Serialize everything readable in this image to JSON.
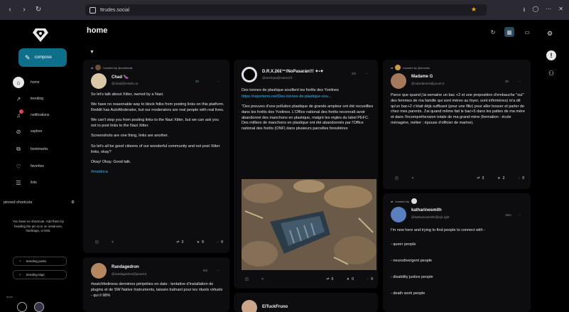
{
  "browser": {
    "url": "ttrudes.social",
    "back_glyph": "‹",
    "forward_glyph": "›",
    "reload_glyph": "↻",
    "right_icons": [
      "⭳",
      "◯",
      "⋯",
      "✕"
    ]
  },
  "sidebar": {
    "compose_label": "compose",
    "items": [
      {
        "label": "home",
        "icon": "home-icon",
        "glyph": "⌂"
      },
      {
        "label": "trending",
        "icon": "trending-icon",
        "glyph": "↗"
      },
      {
        "label": "notifications",
        "icon": "bell-icon",
        "glyph": "♫"
      },
      {
        "label": "explore",
        "icon": "compass-icon",
        "glyph": "⊘"
      },
      {
        "label": "bookmarks",
        "icon": "bookmark-icon",
        "glyph": "⧉"
      },
      {
        "label": "favorites",
        "icon": "heart-icon",
        "glyph": "♡"
      },
      {
        "label": "lists",
        "icon": "list-icon",
        "glyph": "☰"
      }
    ],
    "pinned_title": "pinned shortcuts",
    "pinned_note": "You have no shortcuts. Add them by heading the pin icon on instances, hashtags, or lists.",
    "pinned_buttons": [
      "trending posts",
      "trending tags"
    ],
    "more_label": "more"
  },
  "main": {
    "title": "home",
    "filter_glyph": "▼",
    "posts": [
      {
        "boost_text": "boosted by  @crabenak",
        "name": "Chad 🍆",
        "handle": "@chad@mstdn.ca",
        "meta": "2h",
        "paragraphs": [
          "So let's talk about Xitter, owned by a Nazi.",
          "We have no reasonable way to block folks from posting links on this platform. Reddit has AutoModerator, but our moderators are real people with real lives.",
          "We can't stop you from posting links to the Nazi Xitter, but we can ask you not to post links to the Nazi Xitter.",
          "Screenshots are one thing, links are another.",
          "So let's all be good citizens of our wonderful community and not post Xitter links, okay?",
          "Okay! Okay. Good talk."
        ],
        "hashtag": "#mstdnca",
        "counts": {
          "boosts": "3",
          "favs": "9",
          "replies": "0"
        }
      },
      {
        "name": "Randagedron",
        "handle": "@randagedron@pouet.it",
        "meta": "6m",
        "lines": [
          "#watchfediness dernières péripéties en date : tentative d'installation de plugins et de SW Native Instruments, laissés traînant pour les rituels virtuels - qui il 98%"
        ]
      },
      {
        "name": "D.R.X.2€€™/NoPasarán!!! ✦▪✦",
        "handle": "@seshrpa@mamot.fr",
        "meta": "2m",
        "headline": "Des tonnes de plastique souillent les forêts des Yvelines",
        "link": "https://reporterre.net/Des-tonnes-de-plastique-sou...",
        "quote": "\"Des preuves d'une pollution plastique de grande ampleur ont été recueillies dans les forêts des Yvelines. L'Office national des forêts reconnaît avoir abandonné des manchons en plastique, malgré les règles du label PEFC. Des milliers de manchons en plastique ont été abandonnés par l'Office national des forêts (ONF) dans plusieurs parcelles forestières",
        "counts": {
          "boosts": "0",
          "favs": "0",
          "replies": "0"
        }
      },
      {
        "name": "ElTuckFruno",
        "handle": "",
        "meta": ""
      },
      {
        "boost_text": "boosted by  @tonnels",
        "name": "Madame G",
        "handle": "@cabrdames@pouet.it",
        "meta": "3h",
        "text": "Parce que quand j'ai semaine un bac +2 et une proposition d'embauche \"oui\" des femmes de ma famille qui sont mères au foyer, sont infirmières) m'a dit qu'un bac+2 c'était déjà suffisant (pour une fille) pour aller bosser et parler de chez mes parents. J'ai quand même fait le bac+5 dans les pattes de ma mère et dans l'incompréhension totale de ma grand-mère (formation : école ménagère, métier : épouse d'officier de marine).",
        "counts": {
          "boosts": "3",
          "favs": "2",
          "replies": "0"
        }
      },
      {
        "boost_text": "boosted by",
        "name": "katharinesmith",
        "handle": "@katharinesmith@sjlc.lgbt",
        "meta": "15m",
        "intro": "I'm new here and trying to find people to connect with -",
        "tags": [
          "- queer people",
          "- neurodivergent people",
          "- disability justice people",
          "- death work people"
        ]
      }
    ]
  },
  "rail": {
    "settings_glyph": "⚙",
    "info_glyph": "!",
    "users_glyph": "⚇"
  },
  "colors": {
    "accent": "#0d6f8a",
    "link": "#4bb4e6",
    "card": "#0d0d0f",
    "bg": "#000000"
  }
}
